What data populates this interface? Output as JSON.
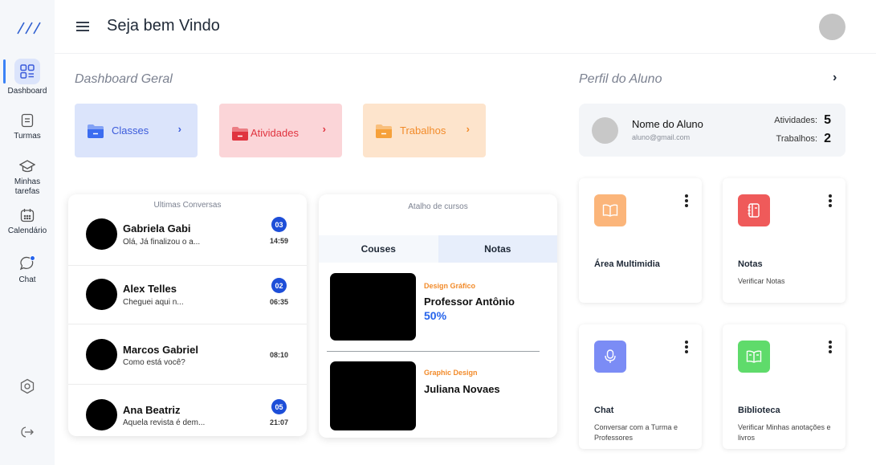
{
  "header": {
    "title": "Seja bem Vindo"
  },
  "sidebar": {
    "items": [
      {
        "label": "Dashboard",
        "icon": "dashboard-icon"
      },
      {
        "label": "Turmas",
        "icon": "document-icon"
      },
      {
        "label": "Minhas tarefas",
        "icon": "graduation-cap-icon"
      },
      {
        "label": "Calendário",
        "icon": "calendar-icon"
      },
      {
        "label": "Chat",
        "icon": "chat-icon"
      }
    ],
    "bottom": [
      {
        "icon": "settings-icon"
      },
      {
        "icon": "logout-icon"
      }
    ]
  },
  "dashboard": {
    "title": "Dashboard Geral",
    "categories": [
      {
        "label": "Classes",
        "color": "#dbe4fb",
        "text_color": "#3b5bdb",
        "icon_color": "#3b6cf0"
      },
      {
        "label": "Atividades",
        "color": "#fbd5d8",
        "text_color": "#e0343f",
        "icon_color": "#e0343f"
      },
      {
        "label": "Trabalhos",
        "color": "#fde4cc",
        "text_color": "#f28b2a",
        "icon_color": "#f6a13a"
      }
    ]
  },
  "conversations": {
    "title": "Ultimas Conversas",
    "items": [
      {
        "name": "Gabriela Gabi",
        "message": "Olá, Já finalizou o a...",
        "badge": "03",
        "time": "14:59"
      },
      {
        "name": "Alex Telles",
        "message": "Cheguei aqui n...",
        "badge": "02",
        "time": "06:35"
      },
      {
        "name": "Marcos Gabriel",
        "message": "Como está você?",
        "badge": "",
        "time": "08:10"
      },
      {
        "name": "Ana Beatriz",
        "message": "Aquela revista é dem...",
        "badge": "05",
        "time": "21:07"
      }
    ]
  },
  "courses": {
    "title": "Atalho de cursos",
    "tabs": [
      {
        "label": "Couses"
      },
      {
        "label": "Notas"
      }
    ],
    "items": [
      {
        "category": "Design Gráfico",
        "teacher": "Professor Antônio",
        "progress": "50%"
      },
      {
        "category": "Graphic Design",
        "teacher": "Juliana Novaes",
        "progress": ""
      }
    ]
  },
  "profile": {
    "title": "Perfil do Aluno",
    "name": "Nome do Aluno",
    "email": "aluno@gmail.com",
    "activities_label": "Atividades:",
    "activities_value": "5",
    "works_label": "Trabalhos:",
    "works_value": "2"
  },
  "tiles": [
    {
      "title": "Área Multimidia",
      "subtitle": "",
      "icon": "book-icon",
      "color": "#fbb57a"
    },
    {
      "title": "Notas",
      "subtitle": "Verificar Notas",
      "icon": "notebook-icon",
      "color": "#ef5a5a"
    },
    {
      "title": "Chat",
      "subtitle": "Conversar com a Turma e Professores",
      "icon": "microphone-icon",
      "color": "#7b8cf5"
    },
    {
      "title": "Biblioteca",
      "subtitle": "Verificar Minhas anotações e livros",
      "icon": "library-icon",
      "color": "#5fdb6b"
    }
  ]
}
